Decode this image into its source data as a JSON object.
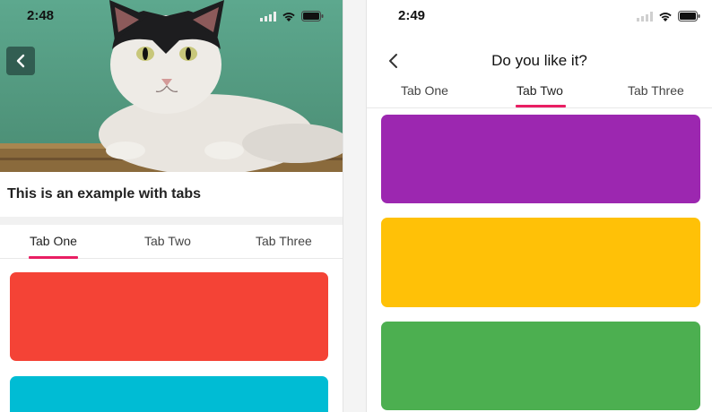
{
  "left": {
    "status_time": "2:48",
    "content_title": "This is an example with tabs",
    "tabs": [
      {
        "label": "Tab One",
        "active": true
      },
      {
        "label": "Tab Two",
        "active": false
      },
      {
        "label": "Tab Three",
        "active": false
      }
    ],
    "cards": [
      {
        "color": "#f44336"
      },
      {
        "color": "#00bcd4"
      }
    ]
  },
  "right": {
    "status_time": "2:49",
    "header_title": "Do you like it?",
    "tabs": [
      {
        "label": "Tab One",
        "active": false
      },
      {
        "label": "Tab Two",
        "active": true
      },
      {
        "label": "Tab Three",
        "active": false
      }
    ],
    "cards": [
      {
        "color": "#9c27b0"
      },
      {
        "color": "#ffc107"
      },
      {
        "color": "#4caf50"
      }
    ]
  },
  "colors": {
    "tab_indicator": "#e91e63",
    "hero_background": "#5a9e87"
  },
  "icons": {
    "back": "chevron-left-icon",
    "signal": "cellular-signal-icon",
    "wifi": "wifi-icon",
    "battery": "battery-icon"
  }
}
